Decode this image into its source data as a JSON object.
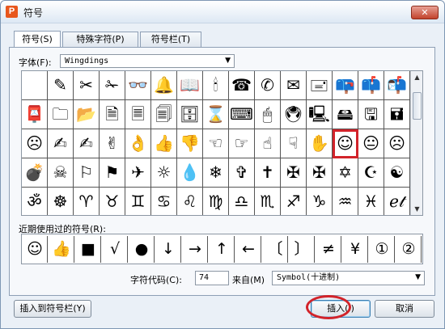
{
  "window": {
    "title": "符号",
    "app_icon_letter": "P",
    "close_label": "✕"
  },
  "tabs": [
    {
      "label": "符号(S)",
      "active": true
    },
    {
      "label": "特殊字符(P)",
      "active": false
    },
    {
      "label": "符号栏(T)",
      "active": false
    }
  ],
  "font": {
    "label": "字体(F):",
    "value": "Wingdings"
  },
  "grid": {
    "selected_index": 42,
    "symbols": [
      "",
      "✎",
      "✂",
      "✁",
      "👓",
      "🔔",
      "📖",
      "🕯",
      "☎",
      "✆",
      "✉",
      "🖃",
      "📪",
      "📫",
      "📬",
      "📮",
      "🗀",
      "📂",
      "🗎",
      "🗏",
      "🗐",
      "🗄",
      "⌛",
      "⌨",
      "🖱",
      "🖲",
      "🖳",
      "🖴",
      "🖫",
      "🖬",
      "☹",
      "✍",
      "✍",
      "✌",
      "👌",
      "👍",
      "👎",
      "☜",
      "☞",
      "☝",
      "☟",
      "✋",
      "☺",
      "😐",
      "☹",
      "💣",
      "☠",
      "⚐",
      "⚑",
      "✈",
      "☼",
      "💧",
      "❄",
      "✞",
      "✝",
      "✠",
      "✠",
      "✡",
      "☪",
      "☯",
      "ॐ",
      "☸",
      "♈",
      "♉",
      "♊",
      "♋",
      "♌",
      "♍",
      "♎",
      "♏",
      "♐",
      "♑",
      "♒",
      "♓",
      "ℯ𝓉"
    ]
  },
  "recent": {
    "label": "近期使用过的符号(R):",
    "symbols": [
      "☺",
      "👍",
      "■",
      "√",
      "●",
      "↓",
      "→",
      "↑",
      "←",
      "〔",
      "〕",
      "≠",
      "¥",
      "①",
      "②"
    ]
  },
  "char_code": {
    "label": "字符代码(C):",
    "value": "74",
    "from_label": "来自(M)",
    "from_value": "Symbol(十进制)"
  },
  "buttons": {
    "insert_to_bar": "插入到符号栏(Y)",
    "insert": "插入(I)",
    "cancel": "取消"
  }
}
